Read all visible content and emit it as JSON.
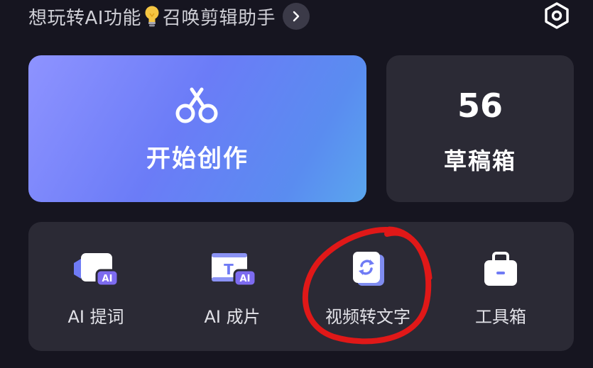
{
  "promo": {
    "text_before": "想玩转AI功能",
    "text_after": "召唤剪辑助手",
    "bulb_icon": "lightbulb-icon",
    "arrow_icon": "chevron-right-icon"
  },
  "settings": {
    "icon": "hexagon-settings-icon"
  },
  "create": {
    "label": "开始创作",
    "icon": "scissors-icon"
  },
  "drafts": {
    "count": "56",
    "label": "草稿箱"
  },
  "tools": [
    {
      "label": "AI 提词",
      "icon": "ai-prompter-icon"
    },
    {
      "label": "AI 成片",
      "icon": "ai-video-icon"
    },
    {
      "label": "视频转文字",
      "icon": "video-to-text-icon"
    },
    {
      "label": "工具箱",
      "icon": "toolbox-icon"
    }
  ],
  "colors": {
    "background": "#161520",
    "card": "#2b2a35",
    "accent_gradient_start": "#8e93ff",
    "accent_gradient_end": "#5aa6ee",
    "annotation": "#e01818"
  }
}
